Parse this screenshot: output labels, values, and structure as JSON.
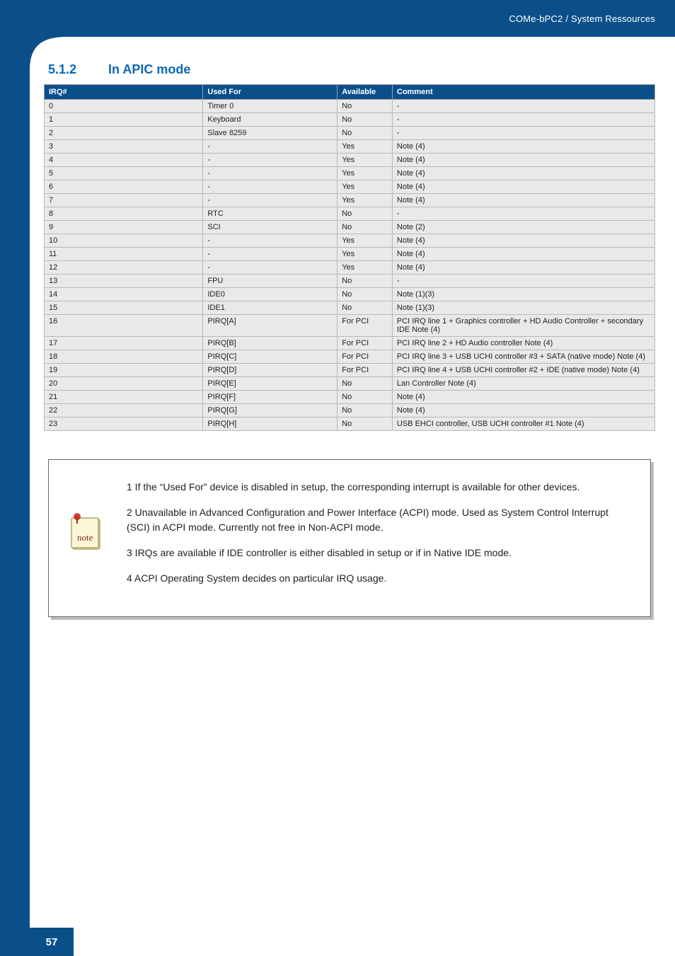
{
  "header": {
    "breadcrumb": "COMe-bPC2 / System Ressources"
  },
  "section": {
    "number": "5.1.2",
    "title": "In APIC mode"
  },
  "table": {
    "columns": [
      "IRQ#",
      "Used For",
      "Available",
      "Comment"
    ],
    "rows": [
      {
        "irq": "0",
        "used": "Timer 0",
        "avail": "No",
        "comment": "-"
      },
      {
        "irq": "1",
        "used": "Keyboard",
        "avail": "No",
        "comment": "-"
      },
      {
        "irq": "2",
        "used": "Slave 8259",
        "avail": "No",
        "comment": "-"
      },
      {
        "irq": "3",
        "used": "-",
        "avail": "Yes",
        "comment": "Note (4)"
      },
      {
        "irq": "4",
        "used": "-",
        "avail": "Yes",
        "comment": "Note (4)"
      },
      {
        "irq": "5",
        "used": "-",
        "avail": "Yes",
        "comment": "Note (4)"
      },
      {
        "irq": "6",
        "used": "-",
        "avail": "Yes",
        "comment": "Note (4)"
      },
      {
        "irq": "7",
        "used": "-",
        "avail": "Yes",
        "comment": "Note (4)"
      },
      {
        "irq": "8",
        "used": "RTC",
        "avail": "No",
        "comment": "-"
      },
      {
        "irq": "9",
        "used": "SCI",
        "avail": "No",
        "comment": "Note (2)"
      },
      {
        "irq": "10",
        "used": "-",
        "avail": "Yes",
        "comment": "Note (4)"
      },
      {
        "irq": "11",
        "used": "-",
        "avail": "Yes",
        "comment": "Note (4)"
      },
      {
        "irq": "12",
        "used": "-",
        "avail": "Yes",
        "comment": "Note (4)"
      },
      {
        "irq": "13",
        "used": "FPU",
        "avail": "No",
        "comment": "-"
      },
      {
        "irq": "14",
        "used": "IDE0",
        "avail": "No",
        "comment": "Note (1)(3)"
      },
      {
        "irq": "15",
        "used": "IDE1",
        "avail": "No",
        "comment": "Note (1)(3)"
      },
      {
        "irq": "16",
        "used": "PIRQ[A]",
        "avail": "For PCI",
        "comment": "PCI IRQ line 1 + Graphics controller + HD Audio Controller + secondary IDE Note (4)"
      },
      {
        "irq": "17",
        "used": "PIRQ[B]",
        "avail": "For PCI",
        "comment": "PCI IRQ line 2 + HD Audio controller Note (4)"
      },
      {
        "irq": "18",
        "used": "PIRQ[C]",
        "avail": "For PCI",
        "comment": "PCI IRQ line 3 + USB UCHI controller #3 + SATA (native mode) Note (4)"
      },
      {
        "irq": "19",
        "used": "PIRQ[D]",
        "avail": "For PCI",
        "comment": "PCI IRQ line 4 + USB UCHI controller #2 + IDE (native mode) Note (4)"
      },
      {
        "irq": "20",
        "used": "PIRQ[E]",
        "avail": "No",
        "comment": "Lan Controller Note (4)"
      },
      {
        "irq": "21",
        "used": "PIRQ[F]",
        "avail": "No",
        "comment": "Note (4)"
      },
      {
        "irq": "22",
        "used": "PIRQ[G]",
        "avail": "No",
        "comment": "Note (4)"
      },
      {
        "irq": "23",
        "used": "PIRQ[H]",
        "avail": "No",
        "comment": "USB EHCI controller, USB UCHI controller #1 Note (4)"
      }
    ]
  },
  "notes": {
    "n1": "1 If the “Used For” device is disabled in setup, the corresponding interrupt is available for other devices.",
    "n2": "2 Unavailable in Advanced Configuration and Power Interface (ACPI) mode. Used as System Control Interrupt (SCI) in ACPI mode. Currently not free in Non-ACPI mode.",
    "n3": "3 IRQs are available if IDE controller is either disabled in setup or if in Native IDE mode.",
    "n4": "4 ACPI Operating System decides on particular IRQ usage.",
    "icon_label": "note"
  },
  "page_number": "57"
}
